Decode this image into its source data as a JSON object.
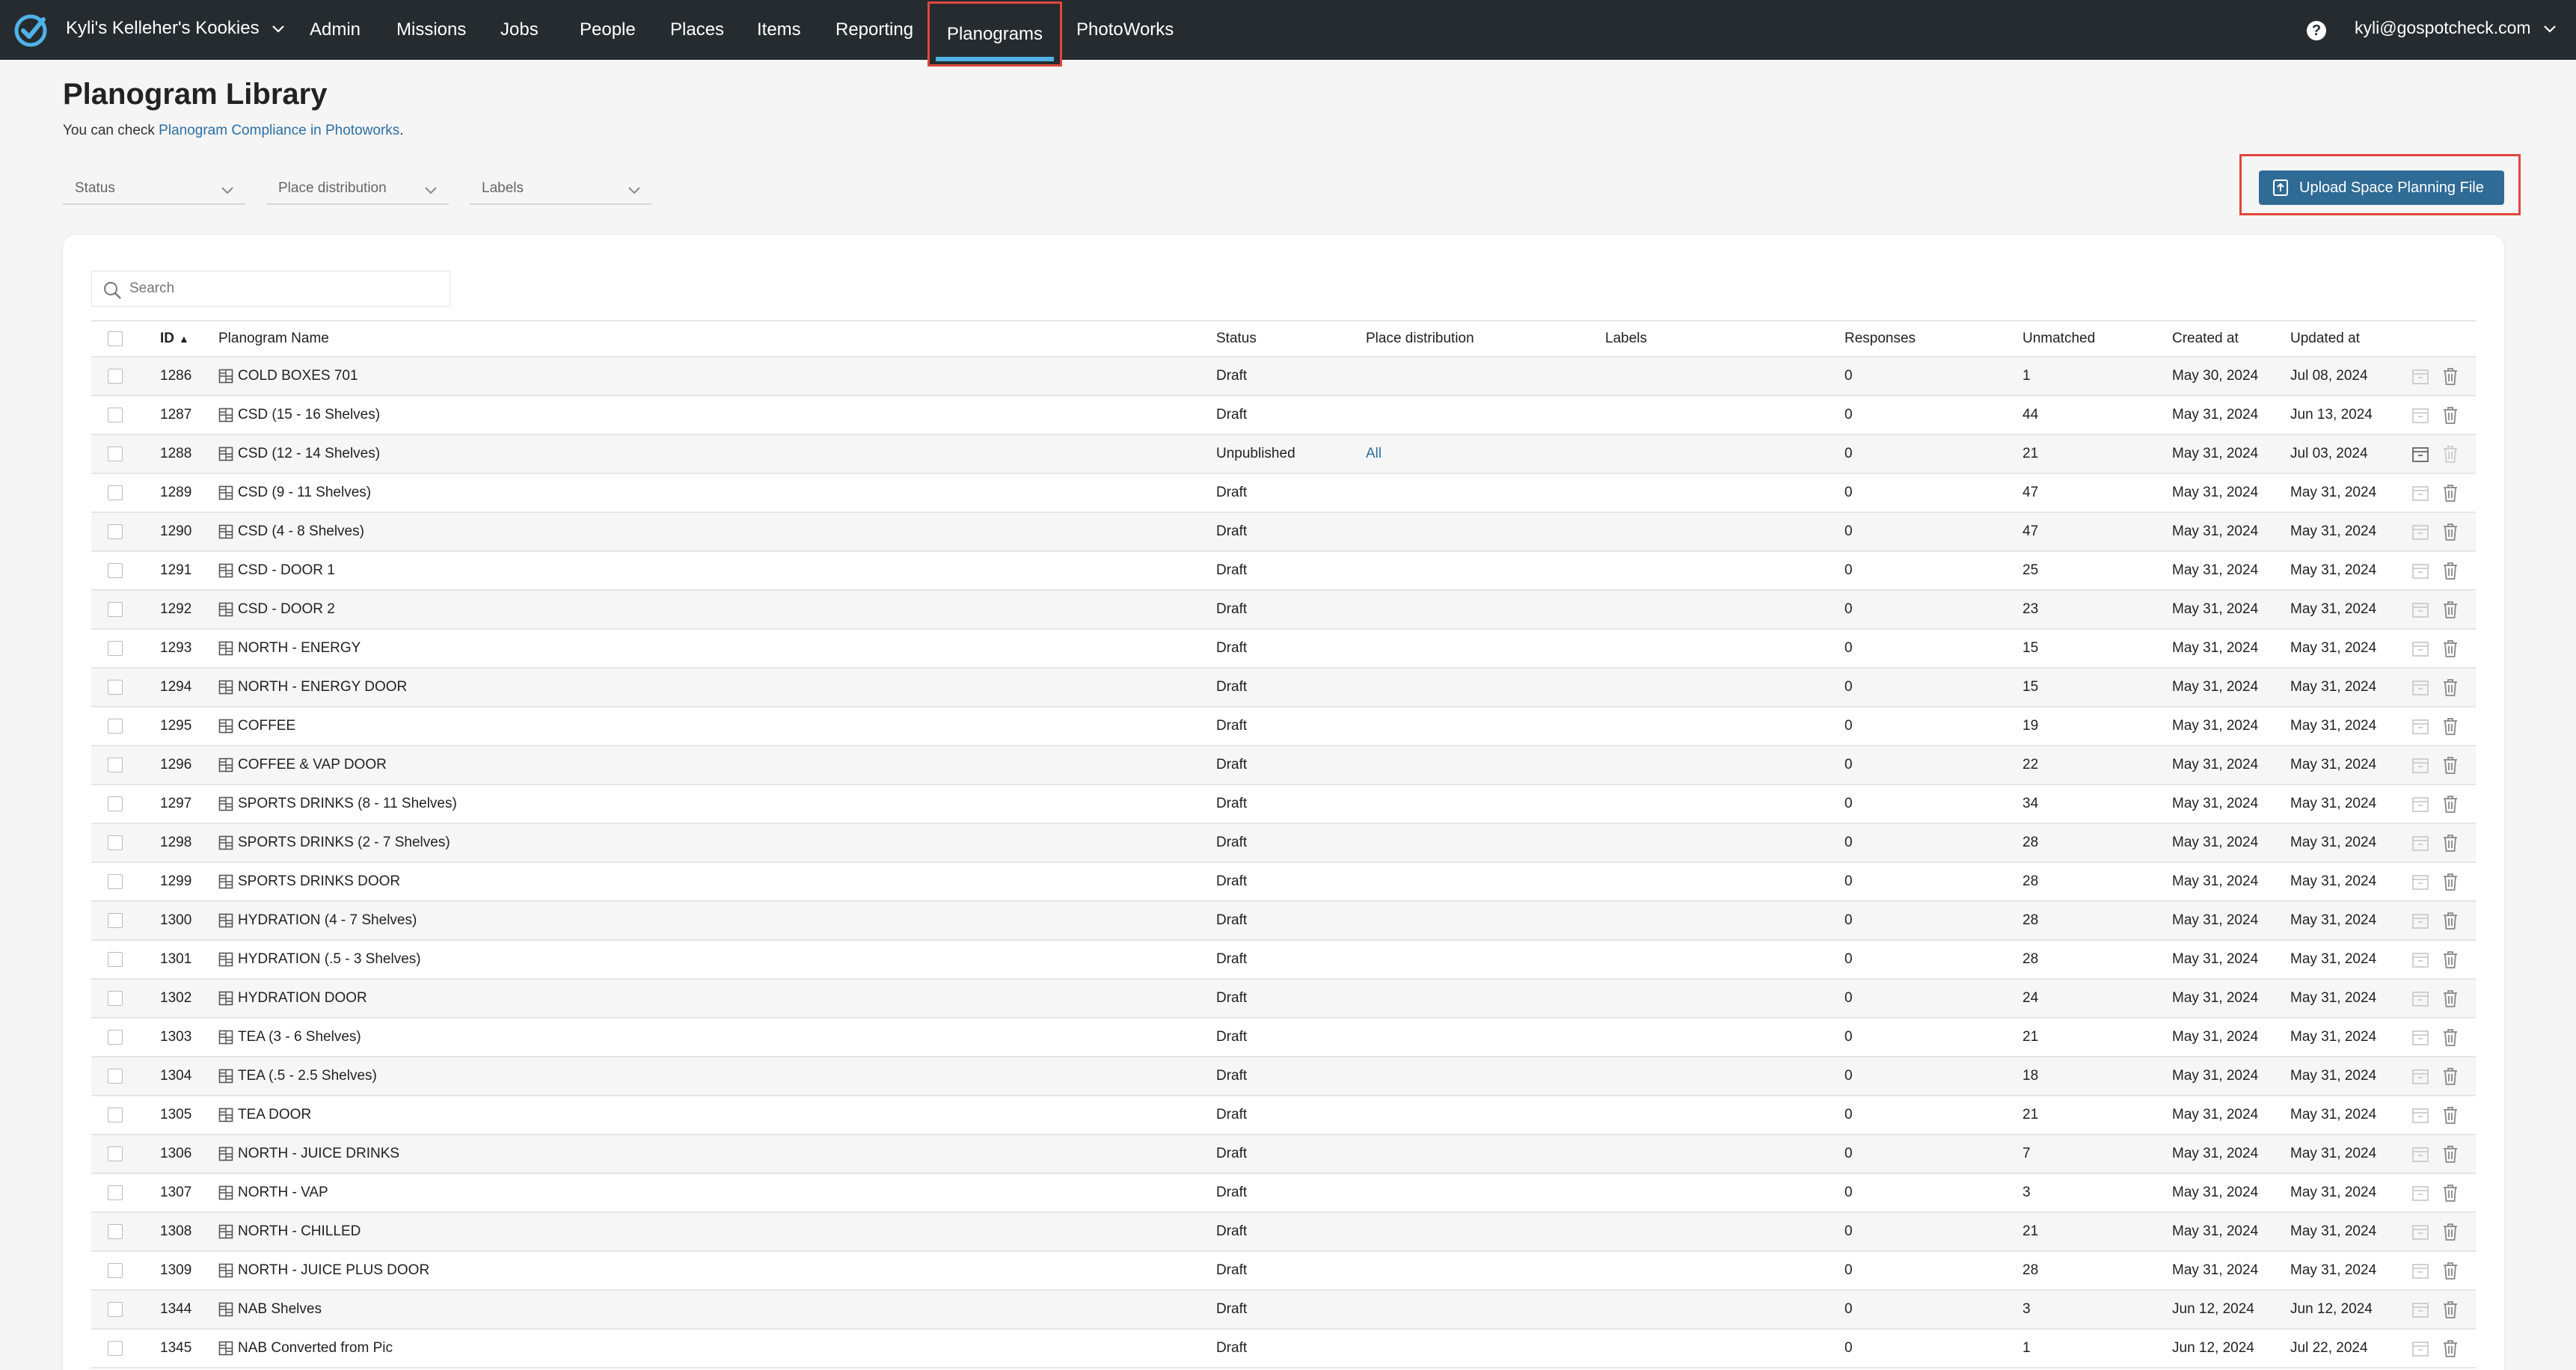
{
  "nav": {
    "org": "Kyli's Kelleher's Kookies",
    "items": [
      {
        "label": "Admin"
      },
      {
        "label": "Missions"
      },
      {
        "label": "Jobs"
      },
      {
        "label": "People"
      },
      {
        "label": "Places"
      },
      {
        "label": "Items"
      },
      {
        "label": "Reporting"
      },
      {
        "label": "Planograms",
        "active": true
      },
      {
        "label": "PhotoWorks"
      }
    ],
    "help": "?",
    "user": "kyli@gospotcheck.com"
  },
  "page": {
    "title": "Planogram Library",
    "subtitle_prefix": "You can check ",
    "subtitle_link": "Planogram Compliance in Photoworks",
    "subtitle_suffix": "."
  },
  "filters": [
    {
      "label": "Status"
    },
    {
      "label": "Place distribution"
    },
    {
      "label": "Labels"
    }
  ],
  "upload_button": "Upload Space Planning File",
  "search_placeholder": "Search",
  "table": {
    "columns": {
      "id": "ID",
      "sort_indicator": "▲",
      "name": "Planogram Name",
      "status": "Status",
      "distribution": "Place distribution",
      "labels": "Labels",
      "responses": "Responses",
      "unmatched": "Unmatched",
      "created": "Created at",
      "updated": "Updated at"
    },
    "rows": [
      {
        "id": "1286",
        "name": "COLD BOXES 701",
        "status": "Draft",
        "distribution": "",
        "labels": "",
        "responses": "0",
        "unmatched": "1",
        "created": "May 30, 2024",
        "updated": "Jul 08, 2024",
        "archive_active": false
      },
      {
        "id": "1287",
        "name": "CSD (15 - 16 Shelves)",
        "status": "Draft",
        "distribution": "",
        "labels": "",
        "responses": "0",
        "unmatched": "44",
        "created": "May 31, 2024",
        "updated": "Jun 13, 2024",
        "archive_active": false
      },
      {
        "id": "1288",
        "name": "CSD (12 - 14 Shelves)",
        "status": "Unpublished",
        "distribution": "All",
        "labels": "",
        "responses": "0",
        "unmatched": "21",
        "created": "May 31, 2024",
        "updated": "Jul 03, 2024",
        "archive_active": true
      },
      {
        "id": "1289",
        "name": "CSD (9 - 11 Shelves)",
        "status": "Draft",
        "distribution": "",
        "labels": "",
        "responses": "0",
        "unmatched": "47",
        "created": "May 31, 2024",
        "updated": "May 31, 2024",
        "archive_active": false
      },
      {
        "id": "1290",
        "name": "CSD (4 - 8 Shelves)",
        "status": "Draft",
        "distribution": "",
        "labels": "",
        "responses": "0",
        "unmatched": "47",
        "created": "May 31, 2024",
        "updated": "May 31, 2024",
        "archive_active": false
      },
      {
        "id": "1291",
        "name": "CSD - DOOR 1",
        "status": "Draft",
        "distribution": "",
        "labels": "",
        "responses": "0",
        "unmatched": "25",
        "created": "May 31, 2024",
        "updated": "May 31, 2024",
        "archive_active": false
      },
      {
        "id": "1292",
        "name": "CSD - DOOR 2",
        "status": "Draft",
        "distribution": "",
        "labels": "",
        "responses": "0",
        "unmatched": "23",
        "created": "May 31, 2024",
        "updated": "May 31, 2024",
        "archive_active": false
      },
      {
        "id": "1293",
        "name": "NORTH - ENERGY",
        "status": "Draft",
        "distribution": "",
        "labels": "",
        "responses": "0",
        "unmatched": "15",
        "created": "May 31, 2024",
        "updated": "May 31, 2024",
        "archive_active": false
      },
      {
        "id": "1294",
        "name": "NORTH - ENERGY DOOR",
        "status": "Draft",
        "distribution": "",
        "labels": "",
        "responses": "0",
        "unmatched": "15",
        "created": "May 31, 2024",
        "updated": "May 31, 2024",
        "archive_active": false
      },
      {
        "id": "1295",
        "name": "COFFEE",
        "status": "Draft",
        "distribution": "",
        "labels": "",
        "responses": "0",
        "unmatched": "19",
        "created": "May 31, 2024",
        "updated": "May 31, 2024",
        "archive_active": false
      },
      {
        "id": "1296",
        "name": "COFFEE & VAP DOOR",
        "status": "Draft",
        "distribution": "",
        "labels": "",
        "responses": "0",
        "unmatched": "22",
        "created": "May 31, 2024",
        "updated": "May 31, 2024",
        "archive_active": false
      },
      {
        "id": "1297",
        "name": "SPORTS DRINKS (8 - 11 Shelves)",
        "status": "Draft",
        "distribution": "",
        "labels": "",
        "responses": "0",
        "unmatched": "34",
        "created": "May 31, 2024",
        "updated": "May 31, 2024",
        "archive_active": false
      },
      {
        "id": "1298",
        "name": "SPORTS DRINKS (2 - 7 Shelves)",
        "status": "Draft",
        "distribution": "",
        "labels": "",
        "responses": "0",
        "unmatched": "28",
        "created": "May 31, 2024",
        "updated": "May 31, 2024",
        "archive_active": false
      },
      {
        "id": "1299",
        "name": "SPORTS DRINKS DOOR",
        "status": "Draft",
        "distribution": "",
        "labels": "",
        "responses": "0",
        "unmatched": "28",
        "created": "May 31, 2024",
        "updated": "May 31, 2024",
        "archive_active": false
      },
      {
        "id": "1300",
        "name": "HYDRATION (4 - 7 Shelves)",
        "status": "Draft",
        "distribution": "",
        "labels": "",
        "responses": "0",
        "unmatched": "28",
        "created": "May 31, 2024",
        "updated": "May 31, 2024",
        "archive_active": false
      },
      {
        "id": "1301",
        "name": "HYDRATION (.5 - 3 Shelves)",
        "status": "Draft",
        "distribution": "",
        "labels": "",
        "responses": "0",
        "unmatched": "28",
        "created": "May 31, 2024",
        "updated": "May 31, 2024",
        "archive_active": false
      },
      {
        "id": "1302",
        "name": "HYDRATION DOOR",
        "status": "Draft",
        "distribution": "",
        "labels": "",
        "responses": "0",
        "unmatched": "24",
        "created": "May 31, 2024",
        "updated": "May 31, 2024",
        "archive_active": false
      },
      {
        "id": "1303",
        "name": "TEA (3 - 6 Shelves)",
        "status": "Draft",
        "distribution": "",
        "labels": "",
        "responses": "0",
        "unmatched": "21",
        "created": "May 31, 2024",
        "updated": "May 31, 2024",
        "archive_active": false
      },
      {
        "id": "1304",
        "name": "TEA (.5 - 2.5 Shelves)",
        "status": "Draft",
        "distribution": "",
        "labels": "",
        "responses": "0",
        "unmatched": "18",
        "created": "May 31, 2024",
        "updated": "May 31, 2024",
        "archive_active": false
      },
      {
        "id": "1305",
        "name": "TEA DOOR",
        "status": "Draft",
        "distribution": "",
        "labels": "",
        "responses": "0",
        "unmatched": "21",
        "created": "May 31, 2024",
        "updated": "May 31, 2024",
        "archive_active": false
      },
      {
        "id": "1306",
        "name": "NORTH - JUICE DRINKS",
        "status": "Draft",
        "distribution": "",
        "labels": "",
        "responses": "0",
        "unmatched": "7",
        "created": "May 31, 2024",
        "updated": "May 31, 2024",
        "archive_active": false
      },
      {
        "id": "1307",
        "name": "NORTH - VAP",
        "status": "Draft",
        "distribution": "",
        "labels": "",
        "responses": "0",
        "unmatched": "3",
        "created": "May 31, 2024",
        "updated": "May 31, 2024",
        "archive_active": false
      },
      {
        "id": "1308",
        "name": "NORTH - CHILLED",
        "status": "Draft",
        "distribution": "",
        "labels": "",
        "responses": "0",
        "unmatched": "21",
        "created": "May 31, 2024",
        "updated": "May 31, 2024",
        "archive_active": false
      },
      {
        "id": "1309",
        "name": "NORTH - JUICE PLUS DOOR",
        "status": "Draft",
        "distribution": "",
        "labels": "",
        "responses": "0",
        "unmatched": "28",
        "created": "May 31, 2024",
        "updated": "May 31, 2024",
        "archive_active": false
      },
      {
        "id": "1344",
        "name": "NAB Shelves",
        "status": "Draft",
        "distribution": "",
        "labels": "",
        "responses": "0",
        "unmatched": "3",
        "created": "Jun 12, 2024",
        "updated": "Jun 12, 2024",
        "archive_active": false
      },
      {
        "id": "1345",
        "name": "NAB Converted from Pic",
        "status": "Draft",
        "distribution": "",
        "labels": "",
        "responses": "0",
        "unmatched": "1",
        "created": "Jun 12, 2024",
        "updated": "Jul 22, 2024",
        "archive_active": false
      }
    ]
  },
  "colors": {
    "nav_bg": "#262b2f",
    "accent_blue": "#4fb3e8",
    "link_blue": "#2d6fa3",
    "button_blue": "#2f6b95",
    "highlight_red": "#e0473d"
  }
}
